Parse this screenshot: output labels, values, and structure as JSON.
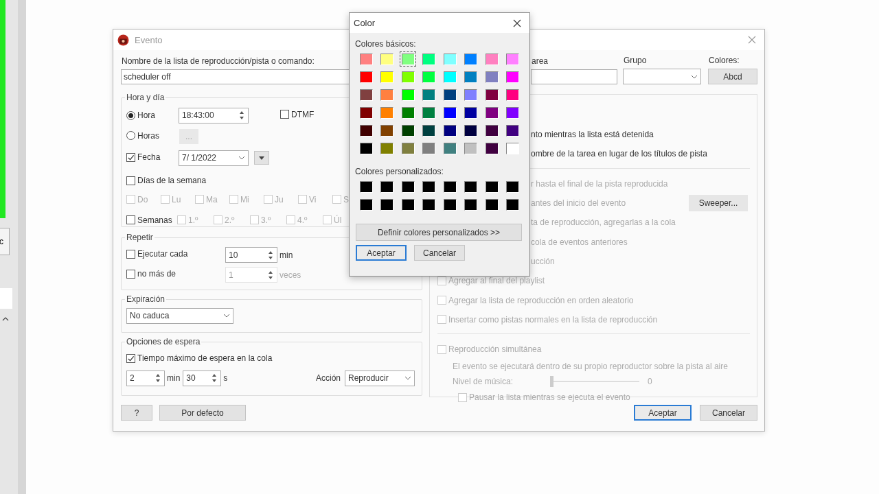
{
  "background_app": {
    "button_label": "c"
  },
  "event_dialog": {
    "title": "Evento",
    "name_label": "Nombre de la lista de reproducción/pista o comando:",
    "name_value": "scheduler off",
    "task_label": "area",
    "group_label": "Grupo",
    "colors_label": "Colores:",
    "colors_button": "Abcd",
    "time_day": {
      "title": "Hora y día",
      "time_radio": {
        "label": "Hora",
        "selected": true
      },
      "time_value": "18:43:00",
      "dtmf": {
        "label": "DTMF",
        "checked": false
      },
      "hours_radio": {
        "label": "Horas",
        "selected": false
      },
      "hours_button": "...",
      "date_check": {
        "label": "Fecha",
        "checked": true
      },
      "date_value": "7/ 1/2022",
      "weekdays_check": {
        "label": "Días de la semana",
        "checked": false
      },
      "days": [
        {
          "label": "Do",
          "checked": false,
          "disabled": true
        },
        {
          "label": "Lu",
          "checked": false,
          "disabled": true
        },
        {
          "label": "Ma",
          "checked": false,
          "disabled": true
        },
        {
          "label": "Mi",
          "checked": false,
          "disabled": true
        },
        {
          "label": "Ju",
          "checked": false,
          "disabled": true
        },
        {
          "label": "Vi",
          "checked": false,
          "disabled": true
        },
        {
          "label": "S",
          "checked": false,
          "disabled": true
        }
      ],
      "weeks_check": {
        "label": "Semanas",
        "checked": false
      },
      "weeks": [
        {
          "label": "1.º",
          "checked": false,
          "disabled": true
        },
        {
          "label": "2.º",
          "checked": false,
          "disabled": true
        },
        {
          "label": "3.º",
          "checked": false,
          "disabled": true
        },
        {
          "label": "4.º",
          "checked": false,
          "disabled": true
        },
        {
          "label": "Úl",
          "checked": false,
          "disabled": true
        }
      ]
    },
    "repeat": {
      "title": "Repetir",
      "every": {
        "label": "Ejecutar cada",
        "checked": false,
        "value": "10",
        "unit": "min",
        "disabled": false
      },
      "max": {
        "label": "no más de",
        "checked": false,
        "value": "1",
        "unit": "veces",
        "disabled": true
      }
    },
    "expiration": {
      "title": "Expiración",
      "value": "No caduca"
    },
    "wait": {
      "title": "Opciones de espera",
      "max_wait": {
        "label": "Tiempo máximo de espera en la cola",
        "checked": true
      },
      "minutes": "2",
      "min_unit": "min",
      "seconds": "30",
      "sec_unit": "s",
      "action_label": "Acción",
      "action_value": "Reproducir"
    },
    "right_panel": {
      "sections": [
        [
          {
            "kind": "fragment",
            "text": "nto mientras la lista está detenida",
            "disabled": false
          },
          {
            "kind": "fragment",
            "text": "ombre de la tarea en lugar de los títulos de pista",
            "disabled": false
          }
        ],
        [
          {
            "kind": "fragment",
            "text": "r hasta el final de la pista reproducida",
            "disabled": true
          },
          {
            "kind": "fragment",
            "text": "antes del inicio del evento",
            "disabled": true,
            "button": "Sweeper..."
          },
          {
            "kind": "fragment",
            "text": "ta de reproducción, agregarlas a la cola",
            "disabled": true
          },
          {
            "kind": "fragment",
            "text": "cola de eventos anteriores",
            "disabled": true
          },
          {
            "kind": "fragment",
            "text": "ucción",
            "disabled": true
          },
          {
            "kind": "check",
            "label": "Agregar al final del playlist",
            "checked": false,
            "disabled": true
          },
          {
            "kind": "check",
            "label": "Agregar la lista de reproducción en orden aleatorio",
            "checked": false,
            "disabled": true
          },
          {
            "kind": "check",
            "label": "Insertar como pistas normales en la lista de reproducción",
            "checked": false,
            "disabled": true
          }
        ],
        [
          {
            "kind": "check",
            "label": "Reproducción simultánea",
            "checked": false,
            "disabled": true
          },
          {
            "kind": "note",
            "text": "El evento se ejecutará dentro de su propio reproductor sobre la pista al aire"
          },
          {
            "kind": "slider",
            "label": "Nivel de música:",
            "level": 0,
            "reading": "0"
          },
          {
            "kind": "subcheck",
            "label": "Pausar la lista mientras se ejecuta el evento",
            "checked": false,
            "disabled": true
          }
        ]
      ]
    },
    "help_button": "?",
    "default_button": "Por defecto",
    "ok_button": "Aceptar",
    "cancel_button": "Cancelar"
  },
  "color_dialog": {
    "title": "Color",
    "basic_label": "Colores básicos:",
    "basic_colors": [
      {
        "color": "#ff8080",
        "selected": false
      },
      {
        "color": "#ffff80",
        "selected": false
      },
      {
        "color": "#80ff80",
        "selected": true
      },
      {
        "color": "#00ff80",
        "selected": false
      },
      {
        "color": "#80ffff",
        "selected": false
      },
      {
        "color": "#0080ff",
        "selected": false
      },
      {
        "color": "#ff80c0",
        "selected": false
      },
      {
        "color": "#ff80ff",
        "selected": false
      },
      {
        "color": "#ff0000",
        "selected": false
      },
      {
        "color": "#ffff00",
        "selected": false
      },
      {
        "color": "#80ff00",
        "selected": false
      },
      {
        "color": "#00ff40",
        "selected": false
      },
      {
        "color": "#00ffff",
        "selected": false
      },
      {
        "color": "#0080c0",
        "selected": false
      },
      {
        "color": "#8080c0",
        "selected": false
      },
      {
        "color": "#ff00ff",
        "selected": false
      },
      {
        "color": "#804040",
        "selected": false
      },
      {
        "color": "#ff8040",
        "selected": false
      },
      {
        "color": "#00ff00",
        "selected": false
      },
      {
        "color": "#008080",
        "selected": false
      },
      {
        "color": "#004080",
        "selected": false
      },
      {
        "color": "#8080ff",
        "selected": false
      },
      {
        "color": "#800040",
        "selected": false
      },
      {
        "color": "#ff0080",
        "selected": false
      },
      {
        "color": "#800000",
        "selected": false
      },
      {
        "color": "#ff8000",
        "selected": false
      },
      {
        "color": "#008000",
        "selected": false
      },
      {
        "color": "#008040",
        "selected": false
      },
      {
        "color": "#0000ff",
        "selected": false
      },
      {
        "color": "#0000a0",
        "selected": false
      },
      {
        "color": "#800080",
        "selected": false
      },
      {
        "color": "#8000ff",
        "selected": false
      },
      {
        "color": "#400000",
        "selected": false
      },
      {
        "color": "#804000",
        "selected": false
      },
      {
        "color": "#004000",
        "selected": false
      },
      {
        "color": "#004040",
        "selected": false
      },
      {
        "color": "#000080",
        "selected": false
      },
      {
        "color": "#000040",
        "selected": false
      },
      {
        "color": "#400040",
        "selected": false
      },
      {
        "color": "#400080",
        "selected": false
      },
      {
        "color": "#000000",
        "selected": false
      },
      {
        "color": "#808000",
        "selected": false
      },
      {
        "color": "#808040",
        "selected": false
      },
      {
        "color": "#808080",
        "selected": false
      },
      {
        "color": "#408080",
        "selected": false
      },
      {
        "color": "#c0c0c0",
        "selected": false
      },
      {
        "color": "#400040",
        "selected": false
      },
      {
        "color": "#ffffff",
        "selected": false
      }
    ],
    "custom_label": "Colores personalizados:",
    "custom_colors": [
      {
        "color": "#000000",
        "selected": false
      },
      {
        "color": "#000000",
        "selected": false
      },
      {
        "color": "#000000",
        "selected": false
      },
      {
        "color": "#000000",
        "selected": false
      },
      {
        "color": "#000000",
        "selected": false
      },
      {
        "color": "#000000",
        "selected": false
      },
      {
        "color": "#000000",
        "selected": false
      },
      {
        "color": "#000000",
        "selected": false
      },
      {
        "color": "#000000",
        "selected": false
      },
      {
        "color": "#000000",
        "selected": false
      },
      {
        "color": "#000000",
        "selected": false
      },
      {
        "color": "#000000",
        "selected": false
      },
      {
        "color": "#000000",
        "selected": false
      },
      {
        "color": "#000000",
        "selected": false
      },
      {
        "color": "#000000",
        "selected": false
      },
      {
        "color": "#000000",
        "selected": false
      }
    ],
    "define_button": "Definir colores personalizados >>",
    "ok_button": "Aceptar",
    "cancel_button": "Cancelar"
  }
}
